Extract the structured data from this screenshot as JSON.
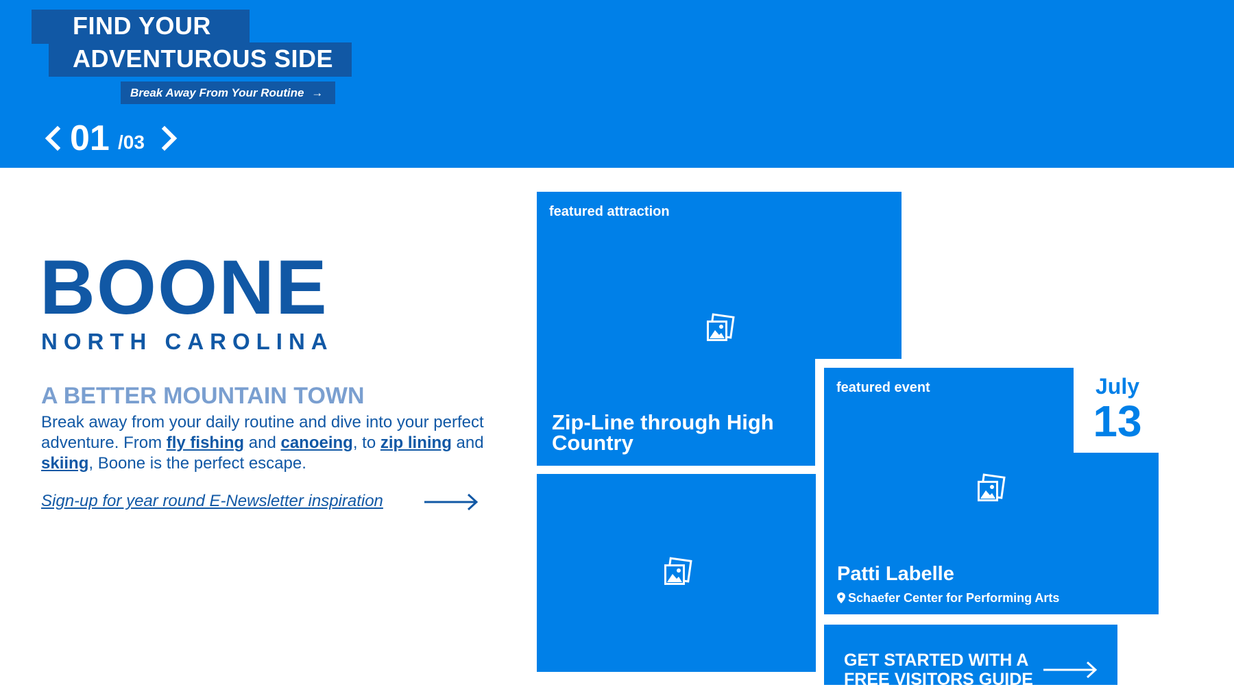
{
  "hero": {
    "title_line1": "FIND YOUR",
    "title_line2": "ADVENTUROUS SIDE",
    "cta_label": "Break Away From Your Routine",
    "pager_current": "01",
    "pager_total": "/03"
  },
  "main": {
    "city": "BOONE",
    "state": "NORTH CAROLINA",
    "tagline": "A BETTER MOUNTAIN TOWN",
    "desc_part1": "Break away from your daily routine and dive into your perfect adventure. From",
    "link_fly_fishing": "fly fishing",
    "desc_and1": "and",
    "link_canoeing": "canoeing",
    "desc_to": ", to",
    "link_zip_lining": "zip lining",
    "desc_and2": "and",
    "link_skiing": "skiing",
    "desc_end": ", Boone is the perfect escape.",
    "newsletter_link": "Sign-up for year round E-Newsletter inspiration"
  },
  "featured_attraction": {
    "label": "featured attraction",
    "name": "Zip-Line through High Country"
  },
  "featured_event": {
    "label": "featured event",
    "month": "July",
    "day": "13",
    "name": "Patti Labelle",
    "venue": "Schaefer Center for Performing Arts"
  },
  "visitors_guide": {
    "label": "GET STARTED WITH A FREE VISITORS GUIDE"
  },
  "colors": {
    "brand_blue": "#0080e8",
    "dark_blue": "#1158a5",
    "tagline_blue": "#7a9fd0"
  },
  "icons": [
    "chevron-left-icon",
    "chevron-right-icon",
    "arrow-right-icon",
    "image-placeholder-icon",
    "map-pin-icon"
  ]
}
